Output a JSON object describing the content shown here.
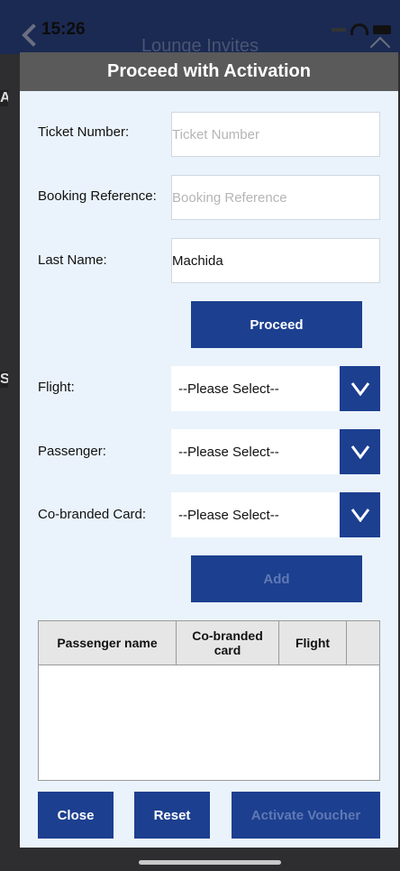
{
  "status_bar": {
    "time": "15:26"
  },
  "background": {
    "title": "Lounge Invites",
    "left_letters": [
      "A",
      "S"
    ]
  },
  "modal": {
    "title": "Proceed with Activation",
    "ticket_label": "Ticket Number:",
    "ticket_placeholder": "Ticket Number",
    "booking_label": "Booking Reference:",
    "booking_placeholder": "Booking Reference",
    "lastname_label": "Last Name:",
    "lastname_value": "Machida",
    "proceed_label": "Proceed",
    "flight_label": "Flight:",
    "flight_value": "--Please Select--",
    "passenger_label": "Passenger:",
    "passenger_value": "--Please Select--",
    "card_label": "Co-branded Card:",
    "card_value": "--Please Select--",
    "add_label": "Add",
    "table_headers": [
      "Passenger name",
      "Co-branded card",
      "Flight",
      ""
    ],
    "close_label": "Close",
    "reset_label": "Reset",
    "activate_label": "Activate Voucher"
  },
  "colors": {
    "brand_blue": "#1c3f8f",
    "header_gray": "#5a5a5a",
    "modal_bg": "#eaf3fb"
  },
  "icons": {
    "select_arrow": "chevron-down-icon",
    "back": "chevron-left-icon",
    "home": "home-icon"
  }
}
